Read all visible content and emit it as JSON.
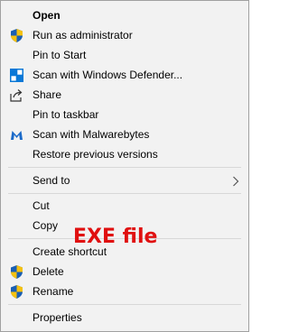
{
  "menu": {
    "open": "Open",
    "run_as_admin": "Run as administrator",
    "pin_to_start": "Pin to Start",
    "scan_defender": "Scan with Windows Defender...",
    "share": "Share",
    "pin_to_taskbar": "Pin to taskbar",
    "scan_malwarebytes": "Scan with Malwarebytes",
    "restore_versions": "Restore previous versions",
    "send_to": "Send to",
    "cut": "Cut",
    "copy": "Copy",
    "create_shortcut": "Create shortcut",
    "delete": "Delete",
    "rename": "Rename",
    "properties": "Properties"
  },
  "overlay_text": "EXE file",
  "colors": {
    "menu_bg": "#f2f2f2",
    "border": "#a0a0a0",
    "separator": "#d8d8d8",
    "overlay": "#e01010",
    "uac_blue": "#1a5fb4",
    "uac_yellow": "#f5c211",
    "defender_blue": "#0a78d7",
    "malwarebytes_blue": "#1b6ac9"
  }
}
